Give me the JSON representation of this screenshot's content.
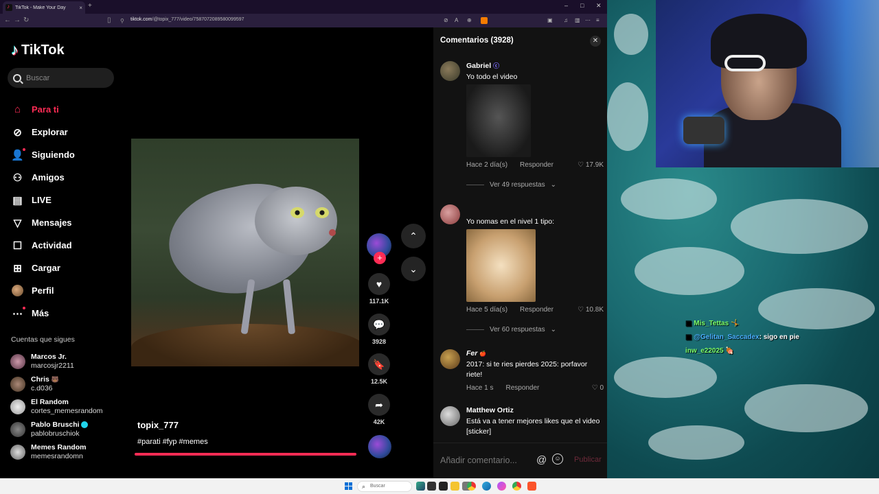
{
  "browser": {
    "tab_title": "TikTok - Make Your Day",
    "tab_close": "×",
    "new_tab": "+",
    "url_host": "tiktok.com",
    "url_path": "/@topix_777/video/7587072089580099597",
    "window_controls": [
      "–",
      "□",
      "✕"
    ]
  },
  "sidebar": {
    "logo": "TikTok",
    "search_placeholder": "Buscar",
    "menu": [
      {
        "label": "Para ti",
        "icon": "home-icon",
        "active": true
      },
      {
        "label": "Explorar",
        "icon": "compass-icon"
      },
      {
        "label": "Siguiendo",
        "icon": "following-icon"
      },
      {
        "label": "Amigos",
        "icon": "friends-icon"
      },
      {
        "label": "LIVE",
        "icon": "live-icon"
      },
      {
        "label": "Mensajes",
        "icon": "messages-icon"
      },
      {
        "label": "Actividad",
        "icon": "activity-icon"
      },
      {
        "label": "Cargar",
        "icon": "upload-icon"
      },
      {
        "label": "Perfil",
        "icon": "profile-avatar"
      },
      {
        "label": "Más",
        "icon": "more-icon"
      }
    ],
    "following_title": "Cuentas que sigues",
    "following": [
      {
        "name": "Marcos Jr.",
        "user": "marcosjr2211"
      },
      {
        "name": "Chris",
        "user": "c.d036"
      },
      {
        "name": "El Random",
        "user": "cortes_memesrandom"
      },
      {
        "name": "Pablo Bruschi",
        "user": "pablobruschiok"
      },
      {
        "name": "Memes Random",
        "user": "memesrandomn"
      }
    ]
  },
  "video": {
    "username": "topix_777",
    "hashtags": "#parati #fyp #memes",
    "likes": "117.1K",
    "comments": "3928",
    "saves": "12.5K",
    "shares": "42K",
    "progress": 1.0
  },
  "comments": {
    "header": "Comentarios (3928)",
    "items": [
      {
        "name": "Gabriel",
        "text": "Yo todo el video",
        "time": "Hace 2 día(s)",
        "reply": "Responder",
        "likes": "17.9K",
        "more": "Ver 49 respuestas"
      },
      {
        "name": "",
        "text": "Yo nomas en el nivel 1 tipo:",
        "time": "Hace 5 día(s)",
        "reply": "Responder",
        "likes": "10.8K",
        "more": "Ver 60 respuestas"
      },
      {
        "name": "Fer",
        "text": "2017: si te ries pierdes 2025: porfavor riete!",
        "time": "Hace 1 s",
        "reply": "Responder",
        "likes": "0"
      },
      {
        "name": "Matthew Ortiz",
        "text": "Está va a tener mejores likes que el video [sticker]"
      }
    ],
    "input_placeholder": "Añadir comentario...",
    "publish": "Publicar"
  },
  "desktop": {
    "chat": [
      {
        "user": "Mis_Tettas",
        "text": ""
      },
      {
        "user": "@Gelitan_Saccadex",
        "text": ": sigo en pie"
      },
      {
        "user": "inw_e22025",
        "text": ""
      }
    ]
  },
  "taskbar": {
    "search": "Buscar"
  }
}
